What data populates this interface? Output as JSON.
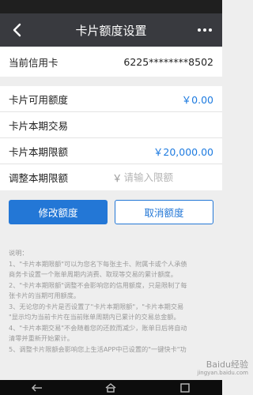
{
  "header": {
    "title": "卡片额度设置",
    "back_icon": "back-chevron-icon",
    "more_icon": "more-dots-icon"
  },
  "card": {
    "label": "当前信用卡",
    "number": "6225********8502"
  },
  "rows": {
    "available_label": "卡片可用额度",
    "available_value": "￥0.00",
    "period_trade_label": "卡片本期交易",
    "period_limit_label": "卡片本期限额",
    "period_limit_value": "￥20,000.00",
    "adjust_label": "调整本期限额",
    "adjust_currency": "￥",
    "adjust_placeholder": "请输入限额"
  },
  "buttons": {
    "modify": "修改额度",
    "cancel": "取消额度"
  },
  "notes": {
    "title": "说明：",
    "line1": "1、\"卡片本期限额\"可以为您名下每张主卡、附属卡或个人承债",
    "line2": "商务卡设置一个账单周期内消费、取现等交易的累计额度。",
    "line3": "2、\"卡片本期限额\"调整不会影响您的信用额度，只是限制了每",
    "line4": "张卡片的当期可用额度。",
    "line5": "3、无论您的卡片是否设置了\"卡片本期限额\"，\"卡片本期交易",
    "line6": "\"显示均为当前卡片在当前账单周期内已累计的交易总金额。",
    "line7": "4、\"卡片本期交易\"不会随着您的还款而减少，账单日后将自动",
    "line8": "清零并重新开始累计。",
    "line9": "5、调整卡片限额会影响您上生活APP中已设置的\"一键快卡\"功"
  },
  "watermark": {
    "brand": "Baidu经验",
    "url": "jingyan.baidu.com"
  },
  "colors": {
    "title_bar": "#393a3f",
    "accent": "#2377d6",
    "background": "#eeeeee"
  }
}
